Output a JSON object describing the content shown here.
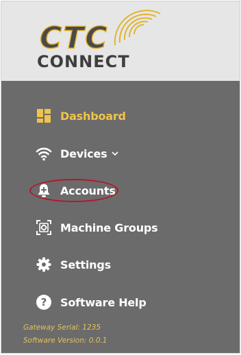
{
  "logo": {
    "brand_top": "CTC",
    "brand_bottom": "CONNECT"
  },
  "nav": {
    "items": [
      {
        "label": "Dashboard",
        "icon": "dashboard-icon",
        "active": true
      },
      {
        "label": "Devices",
        "icon": "wifi-icon",
        "has_dropdown": true
      },
      {
        "label": "Accounts",
        "icon": "account-add-icon"
      },
      {
        "label": "Machine Groups",
        "icon": "machine-groups-icon"
      },
      {
        "label": "Settings",
        "icon": "gear-icon"
      },
      {
        "label": "Software Help",
        "icon": "help-icon"
      }
    ]
  },
  "footer": {
    "gateway_serial": "Gateway Serial: 1235",
    "software_version": "Software Version: 0.0.1"
  },
  "colors": {
    "sidebar_bg": "#6b6b6b",
    "logo_bg": "#e6e6e6",
    "accent": "#f0c34a",
    "highlight_circle": "#b3182b"
  }
}
